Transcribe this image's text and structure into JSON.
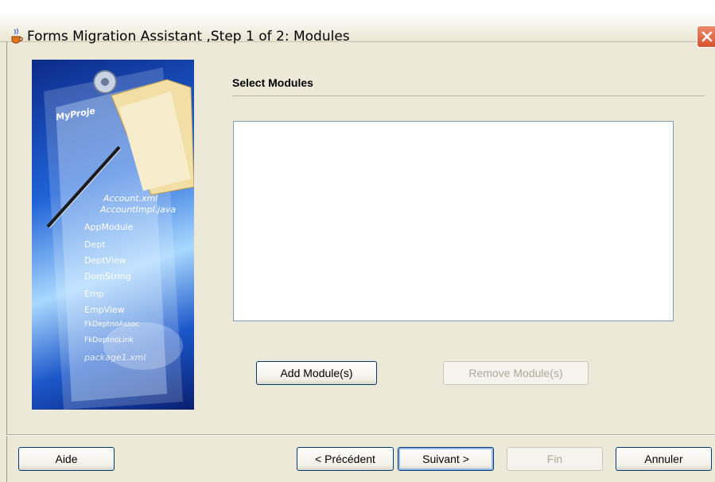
{
  "window": {
    "title": "Forms Migration Assistant ,Step 1 of 2: Modules"
  },
  "panel": {
    "project_label": "MyProje",
    "tree_items": [
      "Account.xml",
      "AccountImpl.java",
      "AppModule",
      "Dept",
      "DeptView",
      "DomString",
      "Emp",
      "EmpView",
      "FkDeptnoAssoc",
      "FkDeptnoLink",
      "package1.xml"
    ]
  },
  "section": {
    "title": "Select Modules"
  },
  "buttons": {
    "add_module": "Add Module(s)",
    "remove_module": "Remove Module(s)",
    "help": "Aide",
    "previous": "< Précédent",
    "next": "Suivant >",
    "finish": "Fin",
    "cancel": "Annuler"
  }
}
